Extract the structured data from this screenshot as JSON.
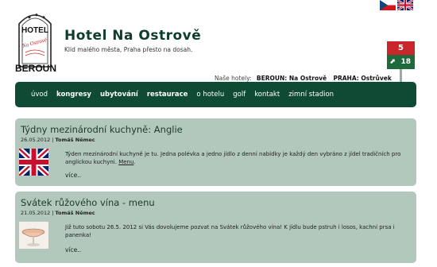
{
  "languages": [
    {
      "code": "cz",
      "icon": "czech-flag"
    },
    {
      "code": "en",
      "icon": "uk-flag"
    }
  ],
  "logo": {
    "text_main": "HOTEL",
    "text_script": "Na Ostrově",
    "town": "BEROUN"
  },
  "header": {
    "title": "Hotel Na Ostrově",
    "tagline": "Klid malého města, Praha přesto na dosah."
  },
  "sign": {
    "top": "5",
    "bottom": "18"
  },
  "other_hotels": {
    "label": "Naše hotely:",
    "links": [
      "BEROUN: Na Ostrově",
      "PRAHA: Ostrůvek"
    ]
  },
  "menu": [
    {
      "label": "úvod",
      "bold": false
    },
    {
      "label": "kongresy",
      "bold": true
    },
    {
      "label": "ubytování",
      "bold": true
    },
    {
      "label": "restaurace",
      "bold": true
    },
    {
      "label": "o hotelu",
      "bold": false
    },
    {
      "label": "golf",
      "bold": false
    },
    {
      "label": "kontakt",
      "bold": false
    },
    {
      "label": "zimní stadion",
      "bold": false
    }
  ],
  "articles": [
    {
      "title": "Týdny mezinárodní kuchyně: Anglie",
      "date": "26.05.2012",
      "separator": "|",
      "author": "Tomáš Němec",
      "text": "Týden mezinárodní kuchyně je tu. Jedna polévka a jedno jídlo z denní nabídky je každý den vybráno z jídel tradičních pro anglickou kuchyni.",
      "link": "Menu",
      "tail": ".",
      "more": "více..",
      "thumb": "uk-flag"
    },
    {
      "title": "Svátek růžového vína - menu",
      "date": "21.05.2012",
      "separator": "|",
      "author": "Tomáš Němec",
      "text": "Již tuto sobotu 26.5. 2012 si Vás dovolujeme pozvat na Svátek růžového vína! K jídlu bude pstruh i losos, kachní prsa i panenka!",
      "link": "",
      "tail": "",
      "more": "více..",
      "thumb": "wine-glass"
    }
  ],
  "colors": {
    "nav": "#0f4a34",
    "article_bg": "#b2c8bd",
    "title": "#0e3d2a",
    "sign_red": "#c8262b",
    "sign_green": "#1f6a3c"
  }
}
